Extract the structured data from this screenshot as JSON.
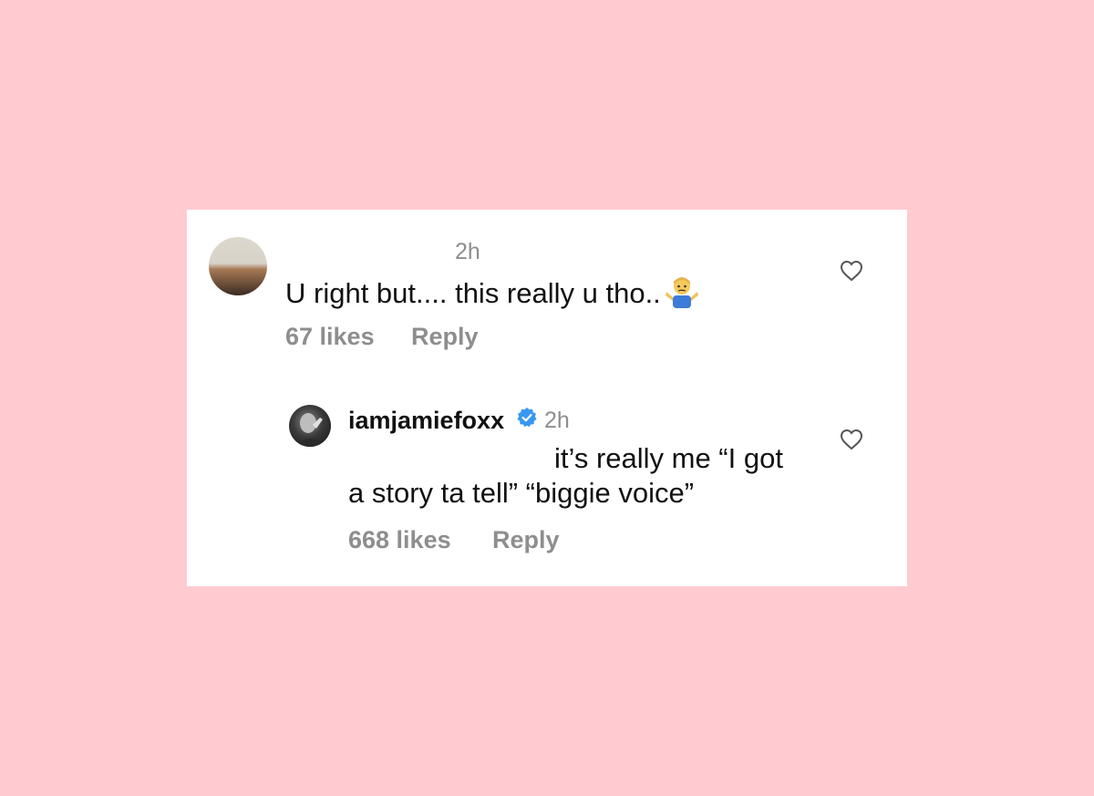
{
  "comments": [
    {
      "time": "2h",
      "text": "U right but.... this really u tho..",
      "emoji_icon": "person-shrugging-emoji",
      "likes": "67 likes",
      "reply": "Reply"
    },
    {
      "username": "iamjamiefoxx",
      "verified_icon": "verified-badge-icon",
      "time": "2h",
      "text_line1": "it’s really me “I got",
      "text_line2": "a story ta tell” “biggie voice”",
      "likes": "668 likes",
      "reply": "Reply"
    }
  ],
  "colors": {
    "background": "#ffcbd0",
    "card": "#ffffff",
    "meta_gray": "#8e8e8e",
    "verified_blue": "#3897f0"
  }
}
